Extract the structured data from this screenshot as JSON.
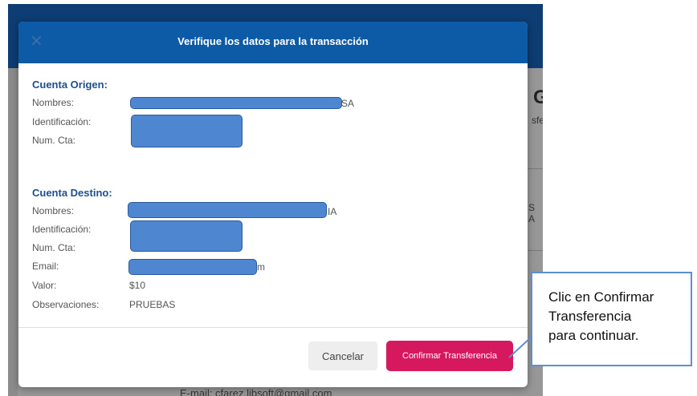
{
  "background": {
    "heading_fragment": "G",
    "fragment_top": "sfe",
    "fragment_mid": "S A",
    "email_line": "E-mail:  cfarez.libsoft@gmail.com"
  },
  "modal": {
    "title": "Verifique los datos para la transacción",
    "close_icon": "close-icon",
    "origen": {
      "title": "Cuenta Origen:",
      "nombres_label": "Nombres:",
      "nombres_suffix": "SA",
      "identificacion_label": "Identificación:",
      "cuenta_label": "Num. Cta:"
    },
    "destino": {
      "title": "Cuenta Destino:",
      "nombres_label": "Nombres:",
      "nombres_suffix": "IA",
      "identificacion_label": "Identificación:",
      "cuenta_label": "Num. Cta:",
      "email_label": "Email:",
      "email_suffix": "m",
      "valor_label": "Valor:",
      "valor": "$10",
      "observaciones_label": "Observaciones:",
      "observaciones": "PRUEBAS"
    },
    "cancel_label": "Cancelar",
    "confirm_label": "Confirmar Transferencia"
  },
  "callout": {
    "text": "Clic en Confirmar\nTransferencia\npara continuar."
  },
  "colors": {
    "header": "#0d5aa7",
    "section_title": "#1e4f8e",
    "confirm_button": "#d6185f",
    "redaction": "#4e87d0",
    "callout_border": "#5b8fd0"
  }
}
